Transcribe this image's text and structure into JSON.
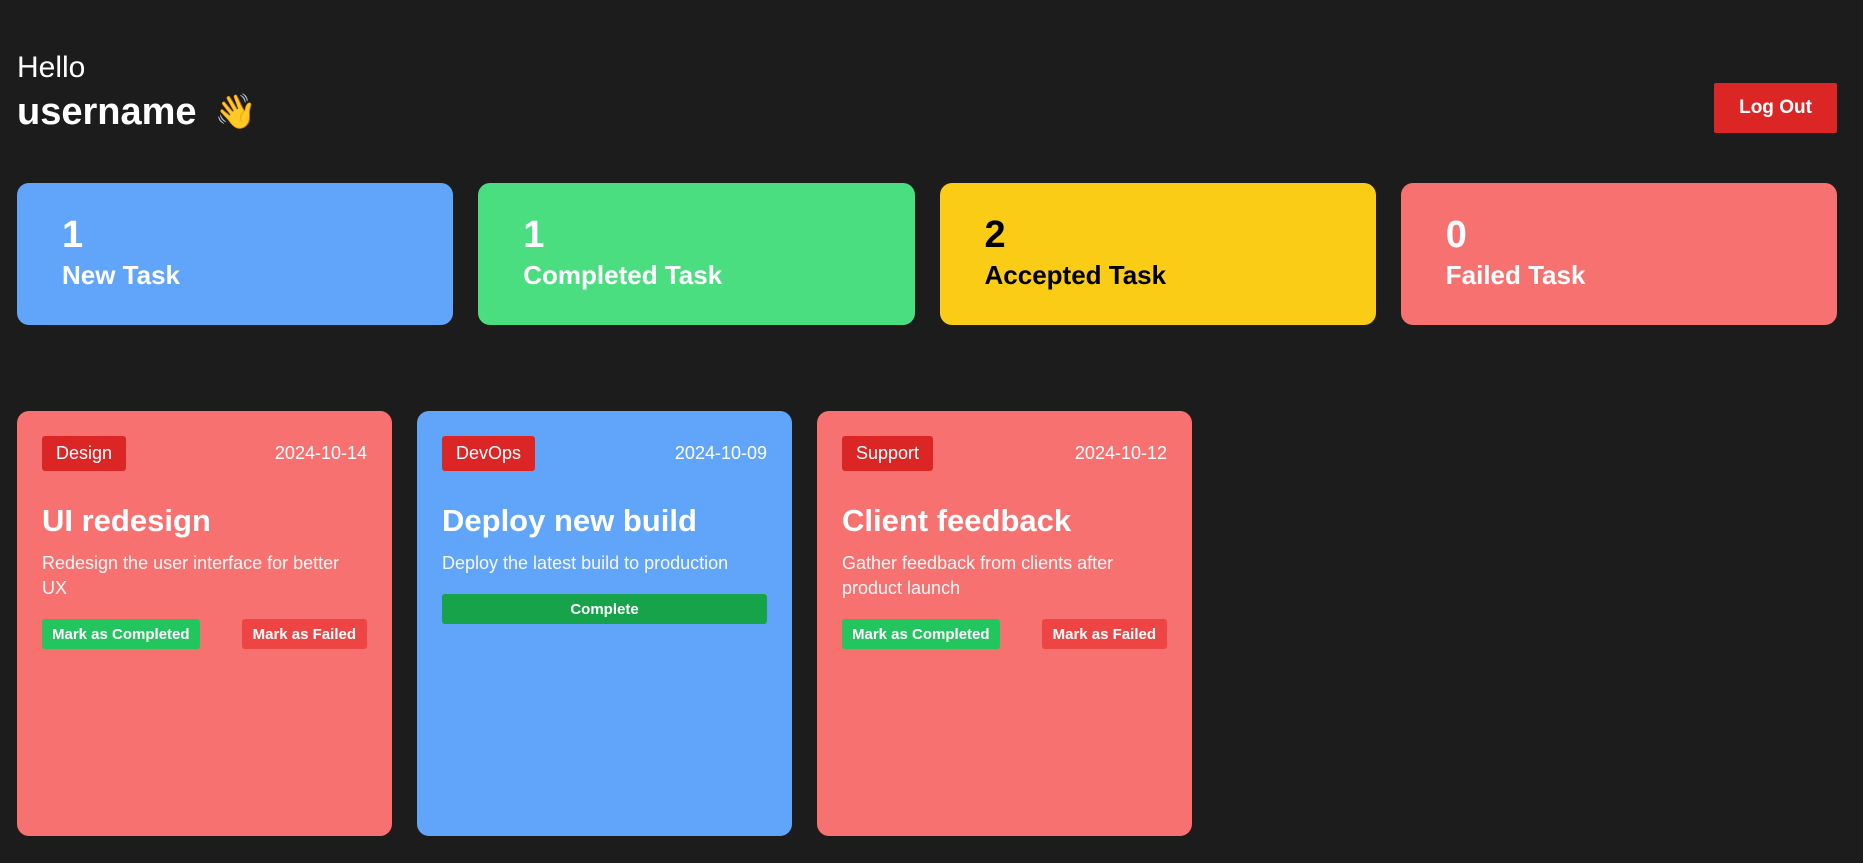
{
  "header": {
    "greeting": "Hello",
    "username": "username",
    "wave": "👋",
    "logout_label": "Log Out"
  },
  "colors": {
    "background": "#1c1c1c",
    "blue": "#60a5fa",
    "green": "#4ade80",
    "yellow": "#facc15",
    "red": "#f87171",
    "tag_red": "#dc2626",
    "logout_red": "#dc2626",
    "complete_green": "#22c55e",
    "failed_red": "#ef4444",
    "complete_dark_green": "#16a34a"
  },
  "stats": [
    {
      "count": "1",
      "label": "New Task",
      "color": "#60a5fa",
      "text_color": "#ffffff"
    },
    {
      "count": "1",
      "label": "Completed Task",
      "color": "#4ade80",
      "text_color": "#ffffff"
    },
    {
      "count": "2",
      "label": "Accepted Task",
      "color": "#facc15",
      "text_color": "#000000"
    },
    {
      "count": "0",
      "label": "Failed Task",
      "color": "#f87171",
      "text_color": "#ffffff"
    }
  ],
  "tasks": [
    {
      "category": "Design",
      "date": "2024-10-14",
      "title": "UI redesign",
      "description": "Redesign the user interface for better UX",
      "color": "#f87171",
      "complete_label": "Mark as Completed",
      "failed_label": "Mark as Failed"
    },
    {
      "category": "DevOps",
      "date": "2024-10-09",
      "title": "Deploy new build",
      "description": "Deploy the latest build to production",
      "color": "#60a5fa",
      "status_label": "Complete"
    },
    {
      "category": "Support",
      "date": "2024-10-12",
      "title": "Client feedback",
      "description": "Gather feedback from clients after product launch",
      "color": "#f87171",
      "complete_label": "Mark as Completed",
      "failed_label": "Mark as Failed"
    }
  ]
}
